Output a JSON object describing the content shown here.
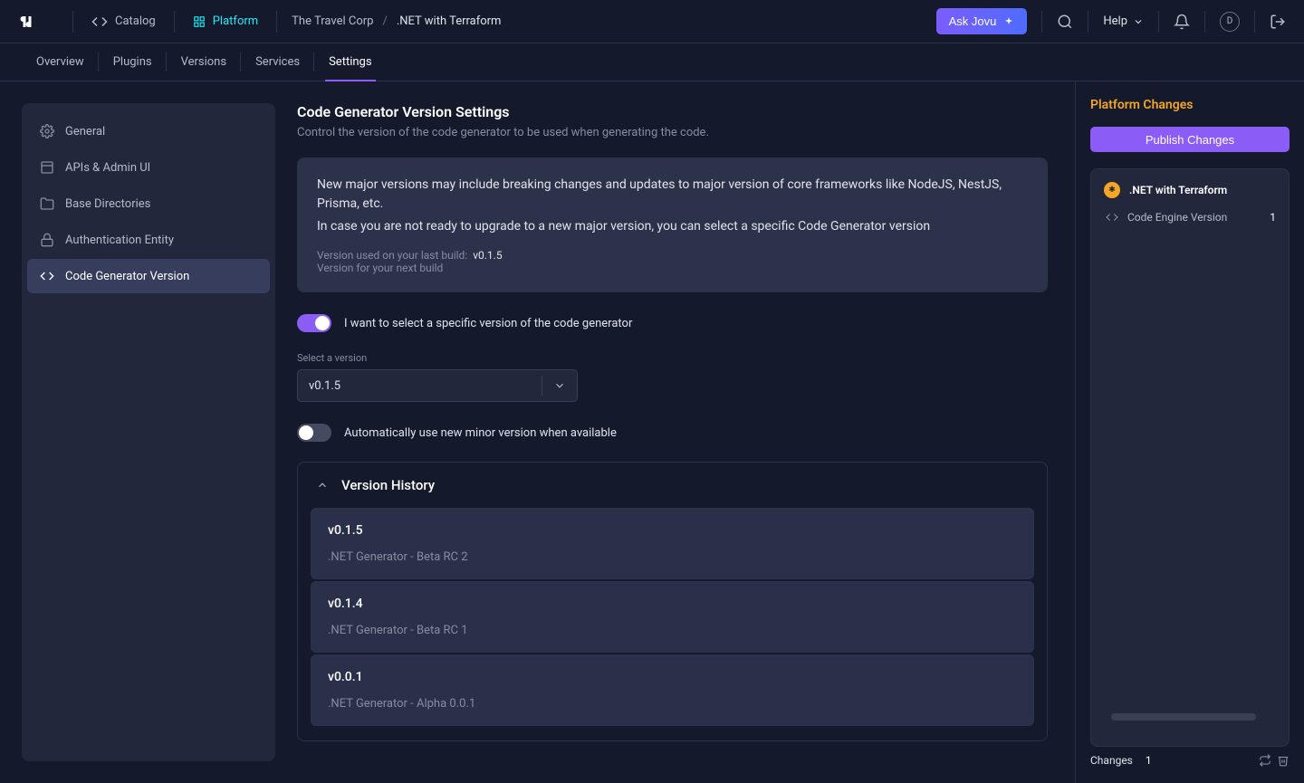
{
  "topbar": {
    "catalog": "Catalog",
    "platform": "Platform",
    "org": "The Travel Corp",
    "project": ".NET with Terraform",
    "ask_jovu": "Ask Jovu",
    "help": "Help",
    "avatar_initial": "D"
  },
  "tabs": [
    "Overview",
    "Plugins",
    "Versions",
    "Services",
    "Settings"
  ],
  "sidebar": [
    "General",
    "APIs & Admin UI",
    "Base Directories",
    "Authentication Entity",
    "Code Generator Version"
  ],
  "page": {
    "title": "Code Generator Version Settings",
    "subtitle": "Control the version of the code generator to be used when generating the code.",
    "info1": "New major versions may include breaking changes and updates to major version of core frameworks like NodeJS, NestJS, Prisma, etc.",
    "info2": "In case you are not ready to upgrade to a new major version, you can select a specific Code Generator version",
    "last_build_label": "Version used on your last build:",
    "last_build_value": "v0.1.5",
    "next_build_label": "Version for your next build",
    "toggle1": "I want to select a specific version of the code generator",
    "select_label": "Select a version",
    "select_value": "v0.1.5",
    "toggle2": "Automatically use new minor version when available",
    "history_title": "Version History",
    "versions": [
      {
        "v": "v0.1.5",
        "d": ".NET Generator - Beta RC 2"
      },
      {
        "v": "v0.1.4",
        "d": ".NET Generator - Beta RC 1"
      },
      {
        "v": "v0.0.1",
        "d": ".NET Generator - Alpha 0.0.1"
      }
    ]
  },
  "rightbar": {
    "title": "Platform Changes",
    "publish": "Publish Changes",
    "project": ".NET with Terraform",
    "change": "Code Engine Version",
    "change_count": "1",
    "footer_label": "Changes",
    "footer_count": "1"
  }
}
